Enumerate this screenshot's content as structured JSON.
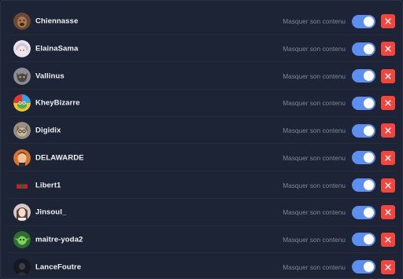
{
  "mask_label": "Masquer son contenu",
  "colors": {
    "background": "#1d2435",
    "toggle_on": "#5d8ff1",
    "remove_button": "#f1453d"
  },
  "users": [
    {
      "name": "Chiennasse",
      "avatar": "dog-portrait",
      "hide_content": true
    },
    {
      "name": "ElainaSama",
      "avatar": "anime-girl",
      "hide_content": true
    },
    {
      "name": "Vallinus",
      "avatar": "cat-face",
      "hide_content": true
    },
    {
      "name": "KheyBizarre",
      "avatar": "colorful-frog",
      "hide_content": true
    },
    {
      "name": "Digidix",
      "avatar": "cat-with-glasses",
      "hide_content": true
    },
    {
      "name": "DELAWARDE",
      "avatar": "man-portrait",
      "hide_content": true
    },
    {
      "name": "Libert1",
      "avatar": "red-flag-emblem",
      "hide_content": true
    },
    {
      "name": "Jinsoul_",
      "avatar": "woman-portrait",
      "hide_content": true
    },
    {
      "name": "maitre-yoda2",
      "avatar": "green-yoda",
      "hide_content": true
    },
    {
      "name": "LanceFoutre",
      "avatar": "dark-figure",
      "hide_content": true
    }
  ]
}
